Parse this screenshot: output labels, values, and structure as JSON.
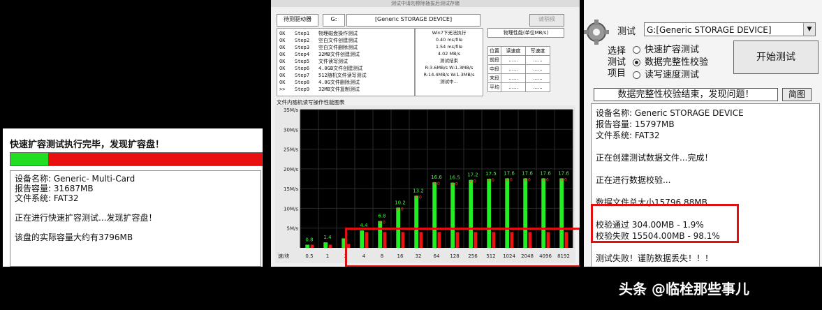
{
  "left": {
    "title": "快速扩容测试执行完毕，发现扩容盘！",
    "progress_good_fraction": 0.15,
    "info_lines": [
      "设备名称: Generic- Multi-Card",
      "报告容量: 31687MB",
      "文件系统: FAT32",
      "",
      "正在进行快速扩容测试...发现扩容盘！",
      "",
      "该盘的实际容量大约有3796MB"
    ]
  },
  "middle": {
    "top_caption": "测试中请勿擦除插拔后测试存储",
    "drive_label": "待测驱动器",
    "drive_letter": "G:",
    "device_name": "[Generic STORAGE DEVICE]",
    "scan_button": "请稍候",
    "steps": [
      {
        "status": "OK",
        "step": "Step1",
        "text": "物理磁盘操作测试"
      },
      {
        "status": "OK",
        "step": "Step2",
        "text": "空白文件创建测试"
      },
      {
        "status": "OK",
        "step": "Step3",
        "text": "空白文件删除测试"
      },
      {
        "status": "OK",
        "step": "Step4",
        "text": "32MB文件创建测试"
      },
      {
        "status": "OK",
        "step": "Step5",
        "text": "文件读写测试"
      },
      {
        "status": "OK",
        "step": "Step6",
        "text": "4.0GB文件创建测试"
      },
      {
        "status": "OK",
        "step": "Step7",
        "text": "512随机文件读写测试"
      },
      {
        "status": "OK",
        "step": "Step8",
        "text": "4.0G文件删除测试"
      },
      {
        "status": ">>",
        "step": "Step9",
        "text": "32MB文件复制测试"
      }
    ],
    "results": [
      "Win7下无法执行",
      "0.40 ms/file",
      "1.54 ms/file",
      "4.02 MB/s",
      "测试结束",
      "R:3.6MB/s W:1.3MB/s",
      "R:14.4MB/s W:1.3MB/s",
      "测试中...",
      ""
    ],
    "perf_title": "物理性能(单位MB/s)",
    "perf_headers": [
      "位置",
      "读速度",
      "写速度"
    ],
    "perf_rows": [
      {
        "pos": "前段",
        "r": "......",
        "w": "......"
      },
      {
        "pos": "中段",
        "r": "......",
        "w": "......"
      },
      {
        "pos": "末段",
        "r": "......",
        "w": "......"
      },
      {
        "pos": "平均",
        "r": "......",
        "w": "......"
      }
    ],
    "chart_title": "文件内随机读写操作性能图表"
  },
  "chart_data": {
    "type": "bar",
    "title": "文件内随机读写操作性能图表",
    "xlabel": "",
    "ylabel": "",
    "corner_label": "速/块",
    "categories": [
      "0.5",
      "1",
      "2",
      "4",
      "8",
      "16",
      "32",
      "64",
      "128",
      "256",
      "512",
      "1024",
      "2048",
      "4096",
      "8192"
    ],
    "ylim": [
      0,
      35
    ],
    "yticks": [
      "35M/s",
      "30M/s",
      "25M/s",
      "20M/s",
      "15M/s",
      "10M/s",
      "5M/s"
    ],
    "series": [
      {
        "name": "",
        "color": "#22ee22",
        "values": [
          0.8,
          1.4,
          2.4,
          4.4,
          6.8,
          10.2,
          13.2,
          16.6,
          16.5,
          17.2,
          17.5,
          17.6,
          17.6,
          17.6,
          17.6
        ]
      },
      {
        "name": "",
        "color": "#ee1111",
        "values": [
          0.8,
          0.8,
          1.0,
          4.0,
          4.0,
          4.0,
          4.0,
          4.0,
          4.0,
          4.0,
          4.0,
          4.0,
          4.0,
          4.0,
          4.0
        ]
      }
    ],
    "green_labels": [
      "0.8",
      "1.4",
      "",
      "4.4",
      "6.8",
      "10.2",
      "13.2",
      "16.6",
      "16.5",
      "17.2",
      "17.5",
      "17.6",
      "17.6",
      "17.6",
      "17.6"
    ],
    "red_labels": [
      "",
      "",
      "",
      "",
      "4.0",
      "4.0",
      "4.0",
      "4.0",
      "4.0",
      "4.0",
      "4.0",
      "4.0",
      "4.0",
      "4.0",
      "4.0"
    ],
    "grid": true,
    "background": "#000000"
  },
  "right": {
    "test_label": "测试",
    "device_value": "G:[Generic STORAGE DEVICE]",
    "select_label_1": "选择",
    "select_label_2": "测试",
    "select_label_3": "项目",
    "radio_options": [
      {
        "label": "快速扩容测试",
        "selected": false
      },
      {
        "label": "数据完整性校验",
        "selected": true
      },
      {
        "label": "读写速度测试",
        "selected": false
      }
    ],
    "start_button": "开始测试",
    "status": "数据完整性校验结束，发现问题！",
    "simple_button": "简图",
    "log_lines": [
      "设备名称: Generic STORAGE DEVICE",
      "报告容量: 15797MB",
      "文件系统: FAT32",
      "",
      "正在创建测试数据文件...完成！",
      "",
      "正在进行数据校验...",
      "",
      "数据文件总大小15796.88MB",
      "",
      "校验通过 304.00MB - 1.9%",
      "校验失败 15504.00MB - 98.1%",
      "",
      "测试失败！谨防数据丢失！！！"
    ]
  },
  "watermark": "头条 @临栓那些事儿"
}
